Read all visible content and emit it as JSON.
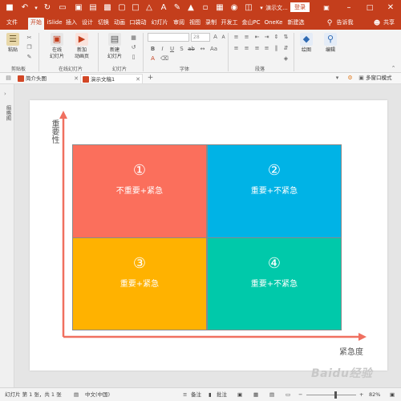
{
  "titlebar": {
    "document_title": "演示文...",
    "login_label": "登录",
    "background": "#c43e1c"
  },
  "menu": {
    "tabs": [
      {
        "label": "文件"
      },
      {
        "label": "开始"
      },
      {
        "label": "iSlide"
      },
      {
        "label": "插入"
      },
      {
        "label": "设计"
      },
      {
        "label": "切换"
      },
      {
        "label": "动画"
      },
      {
        "label": "口袋动"
      },
      {
        "label": "幻灯片"
      },
      {
        "label": "审阅"
      },
      {
        "label": "视图"
      },
      {
        "label": "录制"
      },
      {
        "label": "开发工"
      },
      {
        "label": "金山PC"
      },
      {
        "label": "OneKe"
      },
      {
        "label": "新建选"
      },
      {
        "label": "告诉我"
      },
      {
        "label": "共享"
      }
    ],
    "active_tab": "开始"
  },
  "ribbon": {
    "paste_label": "粘贴",
    "online_slide_label": "在线\n幻灯片",
    "new_anim_label": "新加\n动画页",
    "new_slide_label": "新建\n幻灯片",
    "font_size_value": "28",
    "drawing_label": "绘图",
    "editing_label": "编辑",
    "groups": {
      "clipboard": "剪贴板",
      "online_slides": "在线幻灯片",
      "slides": "幻灯片",
      "font": "字体",
      "paragraph": "段落"
    }
  },
  "docbar": {
    "tabs": [
      {
        "label": "简介头图"
      },
      {
        "label": "演示文稿1"
      }
    ],
    "add_label": "+",
    "multiwindow_label": "多窗口模式"
  },
  "sidepane": {
    "label": "缩略图"
  },
  "slide": {
    "y_axis_label": "重要性",
    "x_axis_label": "紧急度",
    "axis_color": "#f07060",
    "quadrants": [
      {
        "num": "①",
        "label": "不重要+紧急",
        "color": "#fb6f5c"
      },
      {
        "num": "②",
        "label": "重要+不紧急",
        "color": "#00b3e6"
      },
      {
        "num": "③",
        "label": "重要+紧急",
        "color": "#ffb200"
      },
      {
        "num": "④",
        "label": "重要+不紧急",
        "color": "#00c9aa"
      }
    ]
  },
  "statusbar": {
    "slide_info": "幻灯片 第 1 张，共 1 张",
    "language": "中文(中国)",
    "notes_label": "备注",
    "comments_label": "批注",
    "zoom_minus": "−",
    "zoom_plus": "+",
    "zoom_value": "82%"
  },
  "watermark": {
    "text": "Baidu经验"
  }
}
